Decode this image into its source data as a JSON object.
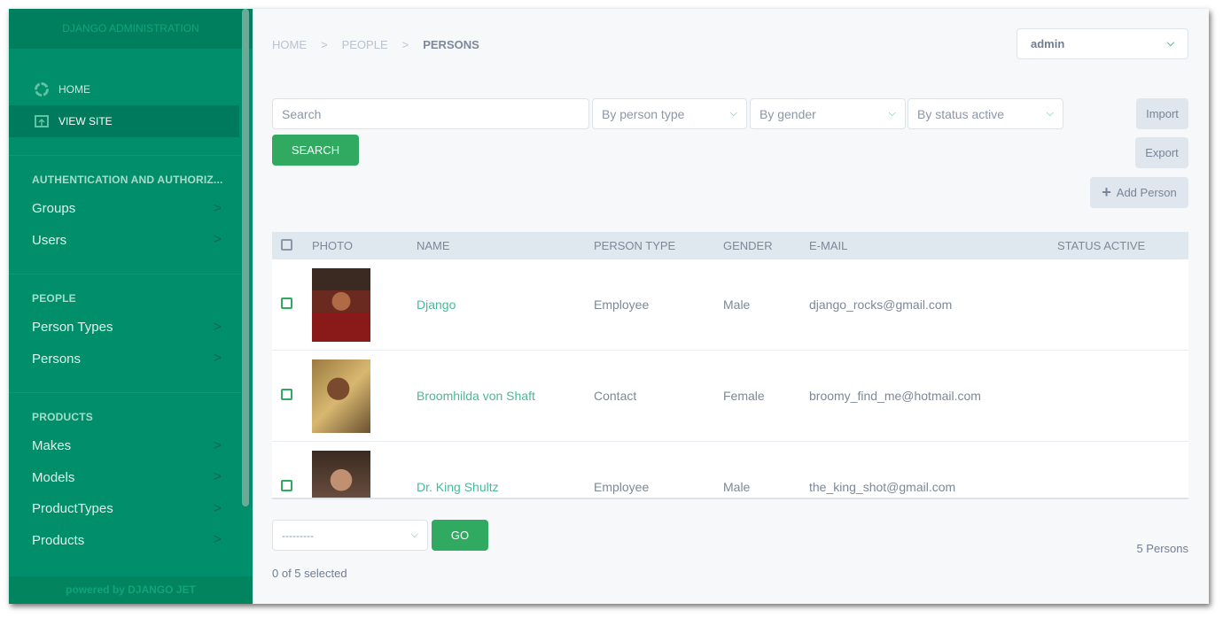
{
  "sidebar": {
    "brand": "DJANGO ADMINISTRATION",
    "home": "HOME",
    "view_site": "VIEW SITE",
    "sections": [
      {
        "title": "AUTHENTICATION AND AUTHORIZ...",
        "items": [
          "Groups",
          "Users"
        ]
      },
      {
        "title": "PEOPLE",
        "items": [
          "Person Types",
          "Persons"
        ]
      },
      {
        "title": "PRODUCTS",
        "items": [
          "Makes",
          "Models",
          "ProductTypes",
          "Products"
        ]
      }
    ],
    "footer": "powered by DJANGO JET"
  },
  "breadcrumb": [
    "HOME",
    "PEOPLE",
    "PERSONS"
  ],
  "user": "admin",
  "filters": {
    "search_placeholder": "Search",
    "person_type": "By person type",
    "gender": "By gender",
    "status": "By status active",
    "search_btn": "SEARCH"
  },
  "actions": {
    "import": "Import",
    "export": "Export",
    "add": "Add Person"
  },
  "table": {
    "headers": [
      "PHOTO",
      "NAME",
      "PERSON TYPE",
      "GENDER",
      "E-MAIL",
      "STATUS ACTIVE"
    ],
    "rows": [
      {
        "name": "Django",
        "type": "Employee",
        "gender": "Male",
        "email": "django_rocks@gmail.com"
      },
      {
        "name": "Broomhilda von Shaft",
        "type": "Contact",
        "gender": "Female",
        "email": "broomy_find_me@hotmail.com"
      },
      {
        "name": "Dr. King Shultz",
        "type": "Employee",
        "gender": "Male",
        "email": "the_king_shot@gmail.com"
      }
    ]
  },
  "bulk": {
    "action": "---------",
    "go": "GO",
    "selected": "0 of 5 selected",
    "count": "5 Persons"
  }
}
